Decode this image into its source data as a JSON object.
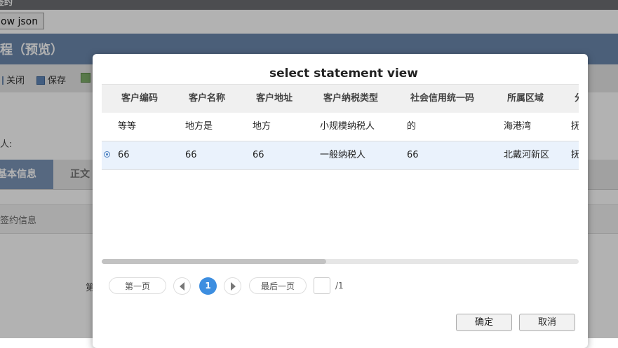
{
  "app": {
    "window_title": "签约",
    "show_json_label": "ow json",
    "page_title": "程（预览）",
    "actions": [
      "关闭",
      "保存"
    ],
    "field_label": "人:",
    "tabs": [
      "基本信息",
      "正文"
    ],
    "section_title": "签约信息",
    "partial_label": "第"
  },
  "dialog": {
    "title": "select statement view",
    "columns": [
      "客户编码",
      "客户名称",
      "客户地址",
      "客户纳税类型",
      "社会信用统一码",
      "所属区域",
      "分"
    ],
    "rows": [
      {
        "selected": false,
        "cells": [
          "等等",
          "地方是",
          "地方",
          "小规模纳税人",
          "的",
          "海港湾",
          "抚"
        ]
      },
      {
        "selected": true,
        "cells": [
          "66",
          "66",
          "66",
          "一般纳税人",
          "66",
          "北戴河新区",
          "抚"
        ]
      }
    ],
    "scroll_position": 0.47,
    "pager": {
      "first_label": "第一页",
      "current_page": "1",
      "last_label": "最后一页",
      "page_input_value": "",
      "total_pages": "/1"
    },
    "ok_label": "确定",
    "cancel_label": "取消"
  },
  "colors": {
    "header_blue": "#6c89ae",
    "active_tab": "#7b95b8",
    "page_active": "#3d8ee0",
    "selected_row": "#eaf2fc"
  }
}
